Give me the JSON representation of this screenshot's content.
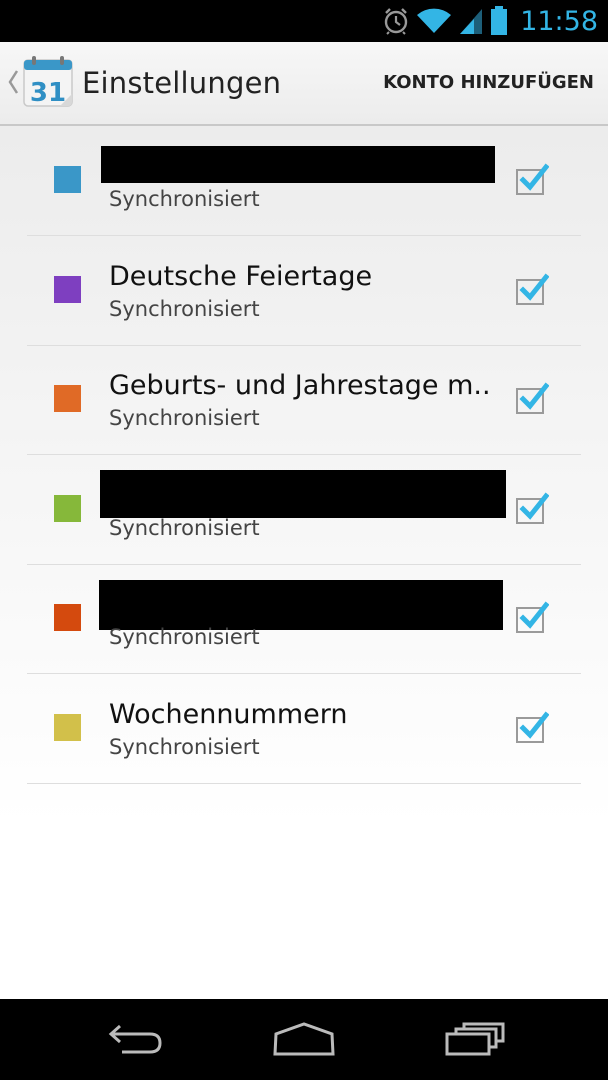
{
  "status_bar": {
    "time": "11:58",
    "icons": [
      "alarm-icon",
      "wifi-icon",
      "signal-icon",
      "battery-icon"
    ],
    "accent": "#33b5e5"
  },
  "action_bar": {
    "app_icon_day": "31",
    "title": "Einstellungen",
    "action_label": "KONTO HINZUFÜGEN"
  },
  "calendars": [
    {
      "name": "",
      "status": "Synchronisiert",
      "color": "#3a97c8",
      "redacted": true,
      "checked": true
    },
    {
      "name": "Deutsche Feiertage",
      "status": "Synchronisiert",
      "color": "#7e3fc0",
      "redacted": false,
      "checked": true
    },
    {
      "name": "Geburts- und Jahrestage m..",
      "status": "Synchronisiert",
      "color": "#e06a26",
      "redacted": false,
      "checked": true
    },
    {
      "name": "",
      "status": "Synchronisiert",
      "color": "#86b83a",
      "redacted": true,
      "checked": true
    },
    {
      "name": "",
      "status": "Synchronisiert",
      "color": "#d44a0e",
      "redacted": true,
      "checked": true
    },
    {
      "name": "Wochennummern",
      "status": "Synchronisiert",
      "color": "#d2c04a",
      "redacted": false,
      "checked": true
    }
  ],
  "nav_bar": {
    "buttons": [
      "back-icon",
      "home-icon",
      "recent-apps-icon"
    ]
  }
}
